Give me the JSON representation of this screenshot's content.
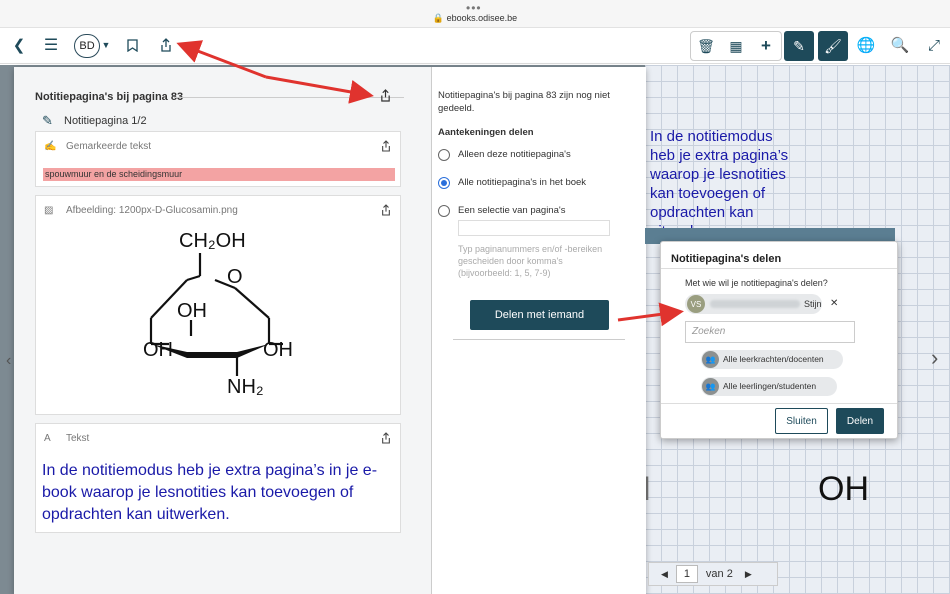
{
  "browser": {
    "url": "ebooks.odisee.be"
  },
  "toolbar": {
    "user_initials": "BD"
  },
  "background": {
    "text": "In de notitiemodus heb je extra pagina’s waarop je lesnotities kan toevoegen of opdrachten kan uitwerken.",
    "oh_left": "OH",
    "oh_right": "OH"
  },
  "panel": {
    "title": "Notitiepagina's bij pagina 83",
    "subhead": "Notitiepagina 1/2",
    "cards": {
      "highlight": {
        "header": "Gemarkeerde tekst",
        "content": "spouwmuur en de scheidingsmuur"
      },
      "image": {
        "header": "Afbeelding: 1200px-D-Glucosamin.png",
        "labels": {
          "ch2oh": "CH₂OH",
          "o": "O",
          "oh_mid": "OH",
          "oh_left": "OH",
          "oh_right": "OH",
          "nh2": "NH₂"
        }
      },
      "text": {
        "header": "Tekst",
        "content": "In de notitiemodus heb je extra pagina’s in je e-book waarop je lesnotities kan toevoegen of opdrachten kan uitwerken."
      }
    }
  },
  "share_settings": {
    "status": "Notitiepagina's bij pagina 83 zijn nog niet gedeeld.",
    "heading": "Aantekeningen delen",
    "options": [
      {
        "label": "Alleen deze notitiepagina's",
        "selected": false
      },
      {
        "label": "Alle notitiepagina's in het boek",
        "selected": true
      },
      {
        "label": "Een selectie van pagina's",
        "selected": false
      }
    ],
    "hint": "Typ paginanummers en/of -bereiken gescheiden door komma's (bijvoorbeeld: 1, 5, 7-9)",
    "button": "Delen met iemand"
  },
  "dialog": {
    "title": "Notitiepagina's delen",
    "question": "Met wie wil je notitiepagina's delen?",
    "recipient": {
      "initials": "VS",
      "name": "Stijn"
    },
    "search_placeholder": "Zoeken",
    "groups": [
      "Alle leerkrachten/docenten",
      "Alle leerlingen/studenten"
    ],
    "close_label": "Sluiten",
    "share_label": "Delen"
  },
  "pager": {
    "current": "1",
    "total_label": "van 2"
  },
  "colors": {
    "primary": "#1e4a5a",
    "arrow": "#e0332e",
    "highlight": "#f3a3a3",
    "note_text": "#1a1aa8"
  }
}
